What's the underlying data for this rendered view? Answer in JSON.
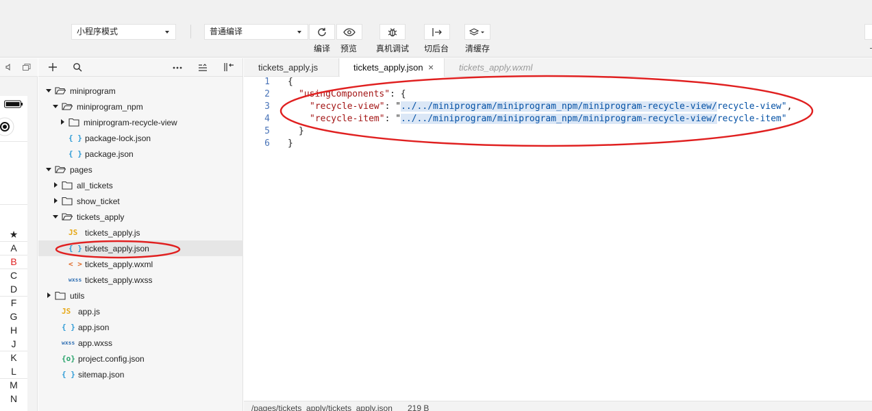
{
  "toolbar": {
    "mode_select": "小程序模式",
    "compile_select": "普通编译",
    "buttons": {
      "compile": "编译",
      "preview": "预览",
      "remote_debug": "真机调试",
      "background": "切后台",
      "clear_cache": "清缓存"
    },
    "icons": {
      "compile": "refresh-icon",
      "preview": "eye-icon",
      "remote_debug": "bug-icon",
      "background": "switch-background-icon",
      "clear_cache": "layers-icon"
    }
  },
  "simulator": {
    "index_star": "★",
    "index_letters": [
      "A",
      "B",
      "C",
      "D",
      "F",
      "G",
      "H",
      "J",
      "K",
      "L",
      "M",
      "N"
    ],
    "active_letter": "B",
    "active_color": "#e02020"
  },
  "file_tree": {
    "items": [
      {
        "label": "miniprogram",
        "kind": "folder",
        "expanded": true,
        "depth": 0
      },
      {
        "label": "miniprogram_npm",
        "kind": "folder",
        "expanded": true,
        "depth": 1
      },
      {
        "label": "miniprogram-recycle-view",
        "kind": "folder",
        "expanded": false,
        "depth": 2
      },
      {
        "label": "package-lock.json",
        "kind": "json",
        "badge": "{ }",
        "depth": 2
      },
      {
        "label": "package.json",
        "kind": "json",
        "badge": "{ }",
        "depth": 2
      },
      {
        "label": "pages",
        "kind": "folder",
        "expanded": true,
        "depth": 0
      },
      {
        "label": "all_tickets",
        "kind": "folder",
        "expanded": false,
        "depth": 1
      },
      {
        "label": "show_ticket",
        "kind": "folder",
        "expanded": false,
        "depth": 1
      },
      {
        "label": "tickets_apply",
        "kind": "folder",
        "expanded": true,
        "depth": 1
      },
      {
        "label": "tickets_apply.js",
        "kind": "js",
        "badge": "JS",
        "depth": 2
      },
      {
        "label": "tickets_apply.json",
        "kind": "json",
        "badge": "{ }",
        "depth": 2,
        "selected": true
      },
      {
        "label": "tickets_apply.wxml",
        "kind": "wxml",
        "badge": "< >",
        "depth": 2
      },
      {
        "label": "tickets_apply.wxss",
        "kind": "wxss",
        "badge": "wxss",
        "depth": 2
      },
      {
        "label": "utils",
        "kind": "folder",
        "expanded": false,
        "depth": 0
      },
      {
        "label": "app.js",
        "kind": "js",
        "badge": "JS",
        "depth": 0
      },
      {
        "label": "app.json",
        "kind": "json",
        "badge": "{ }",
        "depth": 0
      },
      {
        "label": "app.wxss",
        "kind": "wxss",
        "badge": "wxss",
        "depth": 0
      },
      {
        "label": "project.config.json",
        "kind": "config",
        "badge": "{o}",
        "depth": 0
      },
      {
        "label": "sitemap.json",
        "kind": "json",
        "badge": "{ }",
        "depth": 0
      }
    ]
  },
  "editor": {
    "tabs": [
      {
        "label": "tickets_apply.js",
        "active": false
      },
      {
        "label": "tickets_apply.json",
        "active": true,
        "close": "×"
      },
      {
        "label": "tickets_apply.wxml",
        "active": false,
        "preview": true
      }
    ],
    "line_numbers": [
      "1",
      "2",
      "3",
      "4",
      "5",
      "6"
    ],
    "code": {
      "l1": "{",
      "l2_key": "\"usingComponents\"",
      "l2_rest": ": {",
      "l3_key": "\"recycle-view\"",
      "l3_colon": ": \"",
      "l3_val": "../../miniprogram/miniprogram_npm/miniprogram-recycle-view/",
      "l3_tail": "recycle-view\"",
      "l3_end": ",",
      "l4_key": "\"recycle-item\"",
      "l4_colon": ": \"",
      "l4_val": "../../miniprogram/miniprogram_npm/miniprogram-recycle-view/",
      "l4_tail": "recycle-item\"",
      "l5": "}",
      "l6": "}"
    }
  },
  "status": {
    "path": "/pages/tickets_apply/tickets_apply.json",
    "size": "219 B"
  },
  "annotation_color": "#e02020"
}
